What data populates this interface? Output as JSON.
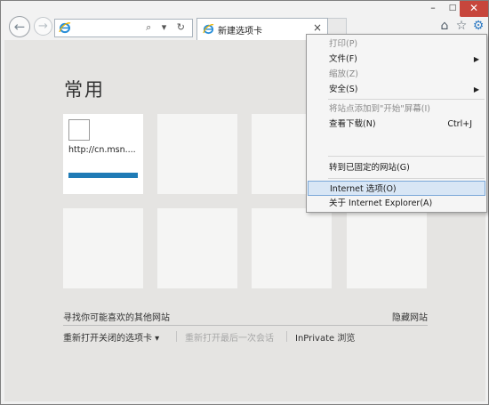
{
  "toolbar": {
    "back_icon": "back-arrow-icon",
    "forward_icon": "forward-arrow-icon",
    "address_value": "",
    "address_tools": "⌕ ▾ ↻"
  },
  "tab": {
    "label": "新建选项卡",
    "close": "×"
  },
  "window_controls": {
    "minimize": "–",
    "maximize": "□",
    "close": "✕"
  },
  "page": {
    "title": "常用",
    "site_tile": {
      "label": "http://cn.msn...."
    },
    "find_sites": "寻找你可能喜欢的其他网站",
    "hide_sites": "隐藏网站",
    "reopen_closed": "重新打开关闭的选项卡 ▾",
    "reopen_last": "重新打开最后一次会话",
    "inprivate": "InPrivate 浏览"
  },
  "menu": {
    "print": "打印(P)",
    "file": "文件(F)",
    "zoom": "缩放(Z)",
    "security": "安全(S)",
    "add_to_start": "将站点添加到\"开始\"屏幕(I)",
    "view_downloads": "查看下载(N)",
    "view_downloads_shortcut": "Ctrl+J",
    "pinned_sites": "转到已固定的网站(G)",
    "internet_options": "Internet 选项(O)",
    "about_ie": "关于 Internet Explorer(A)",
    "arrow": "▶"
  },
  "colors": {
    "accent_blue": "#1f7bb6",
    "close_red": "#c7463c",
    "menu_highlight": "#d8e6f5"
  }
}
